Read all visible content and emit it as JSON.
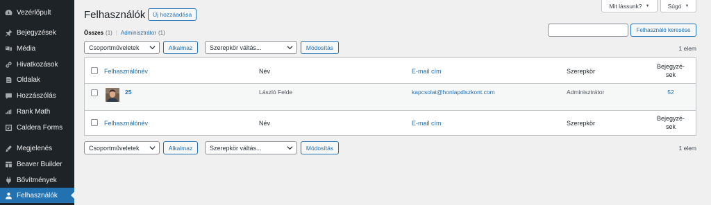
{
  "sidebar": {
    "items": [
      {
        "label": "Vezérlőpult",
        "icon": "dashboard-icon"
      },
      {
        "label": "Bejegyzések",
        "icon": "pin-icon"
      },
      {
        "label": "Média",
        "icon": "media-icon"
      },
      {
        "label": "Hivatkozások",
        "icon": "link-icon"
      },
      {
        "label": "Oldalak",
        "icon": "page-icon"
      },
      {
        "label": "Hozzászólás",
        "icon": "comment-icon"
      },
      {
        "label": "Rank Math",
        "icon": "rank-math-icon"
      },
      {
        "label": "Caldera Forms",
        "icon": "caldera-icon"
      },
      {
        "label": "Megjelenés",
        "icon": "brush-icon"
      },
      {
        "label": "Beaver Builder",
        "icon": "builder-icon"
      },
      {
        "label": "Bővítmények",
        "icon": "plugin-icon"
      },
      {
        "label": "Felhasználók",
        "icon": "users-icon",
        "active": true
      }
    ]
  },
  "screen_options": {
    "label": "Mit lássunk?"
  },
  "help": {
    "label": "Súgó"
  },
  "header": {
    "title": "Felhasználók",
    "add_new": "Új hozzáadása"
  },
  "views": {
    "all_label": "Összes",
    "all_count": "(1)",
    "separator": "|",
    "admin_label": "Adminisztrátor",
    "admin_count": "(1)"
  },
  "search": {
    "placeholder": "",
    "button": "Felhasználó keresése"
  },
  "bulk_top": {
    "bulk_select": "Csoportműveletek",
    "apply": "Alkalmaz",
    "role_select": "Szerepkör váltás...",
    "change": "Módosítás",
    "count": "1 elem"
  },
  "bulk_bottom": {
    "bulk_select": "Csoportműveletek",
    "apply": "Alkalmaz",
    "role_select": "Szerepkör váltás...",
    "change": "Módosítás",
    "count": "1 elem"
  },
  "table": {
    "columns": {
      "username": "Felhasználónév",
      "name": "Név",
      "email": "E-mail cím",
      "role": "Szerepkör",
      "posts_line1": "Bejegyzé-",
      "posts_line2": "sek"
    },
    "rows": [
      {
        "username": "25",
        "name": "László Felde",
        "email": "kapcsolat@honlapdiszkont.com",
        "role": "Adminisztrátor",
        "posts": "52"
      }
    ]
  },
  "colors": {
    "sidebar_bg": "#1d2327",
    "active_bg": "#2271b1",
    "link": "#2271b1",
    "page_bg": "#f0f0f1"
  }
}
